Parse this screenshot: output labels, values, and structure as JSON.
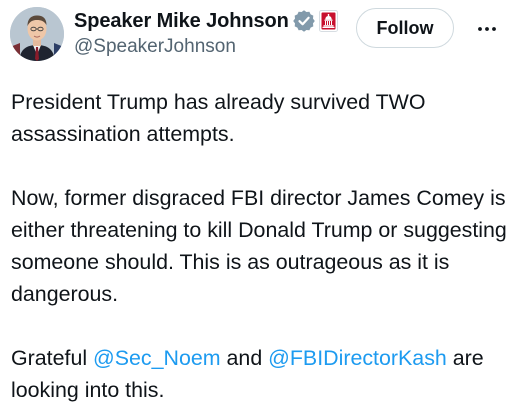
{
  "author": {
    "display_name": "Speaker Mike Johnson",
    "handle": "@SpeakerJohnson",
    "verified_icon": "verified-badge-icon",
    "affiliation_icon": "capitol-affiliation-icon",
    "avatar": "profile-photo"
  },
  "actions": {
    "follow_label": "Follow",
    "more_icon": "more-options-icon"
  },
  "tweet": {
    "paragraph_1": "President Trump has already survived TWO assassination attempts.",
    "paragraph_2": "Now, former disgraced FBI director James Comey is either threatening to kill Donald Trump or suggesting someone should. This is as outrageous as it is dangerous.",
    "paragraph_3_prefix": "Grateful ",
    "mention_1": "@Sec_Noem",
    "paragraph_3_middle": " and ",
    "mention_2": "@FBIDirectorKash",
    "paragraph_3_suffix": " are looking into this."
  },
  "colors": {
    "text": "#0f1419",
    "secondary_text": "#536471",
    "link": "#1d9bf0",
    "verified_badge": "#829aab",
    "affiliation_badge": "#c8102e",
    "button_border": "#cfd9de"
  }
}
